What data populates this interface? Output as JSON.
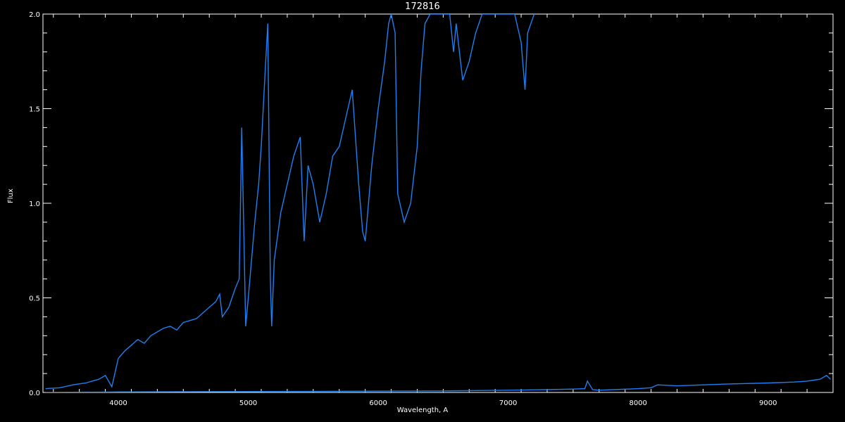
{
  "chart_data": {
    "type": "line",
    "title": "172816",
    "xlabel": "Wavelength, A",
    "ylabel": "Flux",
    "xlim": [
      3420,
      9500
    ],
    "ylim": [
      0,
      2.0
    ],
    "xticks": [
      4000,
      5000,
      6000,
      7000,
      8000,
      9000
    ],
    "yticks": [
      0.0,
      0.5,
      1.0,
      1.5,
      2.0
    ],
    "ytick_labels": [
      "0.0",
      "0.5",
      "1.0",
      "1.5",
      "2.0"
    ],
    "grid": false,
    "background": "#000000",
    "axis_color": "#ffffff",
    "series": [
      {
        "color": "#1e7ff0",
        "x": [
          3440,
          3550,
          3650,
          3750,
          3850,
          3900,
          3950,
          3980,
          4000,
          4050,
          4100,
          4150,
          4200,
          4250,
          4300,
          4350,
          4400,
          4450,
          4500,
          4550,
          4600,
          4650,
          4700,
          4750,
          4780,
          4800,
          4850,
          4900,
          4930,
          4950,
          4980,
          5000,
          5050,
          5080,
          5100,
          5130,
          5150,
          5170,
          5180,
          5200,
          5250,
          5300,
          5350,
          5400,
          5430,
          5460,
          5500,
          5550,
          5600,
          5650,
          5700,
          5750,
          5800,
          5850,
          5880,
          5900,
          5950,
          6000,
          6050,
          6080,
          6100,
          6130,
          6150,
          6200,
          6250,
          6300,
          6330,
          6360,
          6400,
          6450,
          6500,
          6550,
          6580,
          6600,
          6650,
          6700,
          6750,
          6800,
          6850,
          6900,
          6950,
          7000,
          7050,
          7100,
          7130,
          7150,
          7200
        ],
        "y": [
          0.02,
          0.025,
          0.04,
          0.05,
          0.07,
          0.09,
          0.03,
          0.12,
          0.18,
          0.22,
          0.25,
          0.28,
          0.26,
          0.3,
          0.32,
          0.34,
          0.35,
          0.33,
          0.37,
          0.38,
          0.39,
          0.42,
          0.45,
          0.48,
          0.52,
          0.4,
          0.45,
          0.55,
          0.6,
          1.4,
          0.35,
          0.5,
          0.9,
          1.1,
          1.3,
          1.7,
          1.95,
          0.6,
          0.35,
          0.7,
          0.95,
          1.1,
          1.25,
          1.35,
          0.8,
          1.2,
          1.1,
          0.9,
          1.05,
          1.25,
          1.3,
          1.45,
          1.6,
          1.1,
          0.85,
          0.8,
          1.2,
          1.5,
          1.75,
          1.95,
          2.0,
          1.9,
          1.05,
          0.9,
          1.0,
          1.3,
          1.7,
          1.95,
          2.0,
          2.0,
          2.0,
          2.0,
          1.8,
          1.95,
          1.65,
          1.75,
          1.9,
          2.0,
          2.0,
          2.0,
          2.0,
          2.0,
          2.0,
          1.85,
          1.6,
          1.9,
          2.0
        ]
      },
      {
        "color": "#1e7ff0",
        "x": [
          3440,
          4000,
          4500,
          5000,
          5500,
          6000,
          6500,
          7000,
          7300,
          7500,
          7590,
          7610,
          7650,
          7700,
          8000,
          8100,
          8150,
          8300,
          8500,
          8700,
          9000,
          9200,
          9300,
          9350,
          9400,
          9450,
          9480
        ],
        "y": [
          0.0,
          0.003,
          0.004,
          0.005,
          0.006,
          0.007,
          0.008,
          0.012,
          0.015,
          0.018,
          0.02,
          0.06,
          0.015,
          0.012,
          0.02,
          0.025,
          0.04,
          0.035,
          0.04,
          0.045,
          0.05,
          0.055,
          0.06,
          0.065,
          0.07,
          0.09,
          0.07
        ]
      }
    ]
  }
}
